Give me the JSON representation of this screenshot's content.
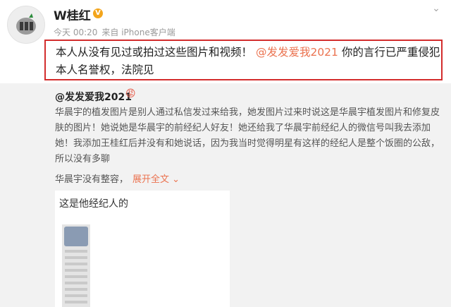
{
  "author": {
    "name": "W桂红",
    "verified_badge": "V",
    "time": "今天 00:20",
    "source": "来自 iPhone客户端"
  },
  "post": {
    "text_before": "本人从没有见过或拍过这些图片和视频！",
    "mention": "@发发爱我2021",
    "text_after": "你的言行已严重侵犯本人名誉权，法院见"
  },
  "repost": {
    "user": "@发发爱我2021",
    "emoji": "😡",
    "text": "华晨宇的植发图片是别人通过私信发过来给我，她发图片过来时说这是华晨宇植发图片和修复皮肤的图片！她说她是华晨宇的前经纪人好友！她还给我了华晨宇前经纪人的微信号叫我去添加她！我添加王桂红后并没有和她说话，因为我当时觉得明星有这样的经纪人是整个饭圈的公敌，所以没有多聊",
    "more_text": "华晨宇没有整容，",
    "expand_label": "展开全文",
    "image_caption": "这是他经纪人的"
  },
  "icons": {
    "avatar": "avatar-image",
    "menu": "chevron-down-icon",
    "expand": "chevron-down-icon"
  },
  "colors": {
    "highlight_box": "#d32d2d",
    "mention": "#eb7350",
    "badge": "#f3a51c"
  }
}
